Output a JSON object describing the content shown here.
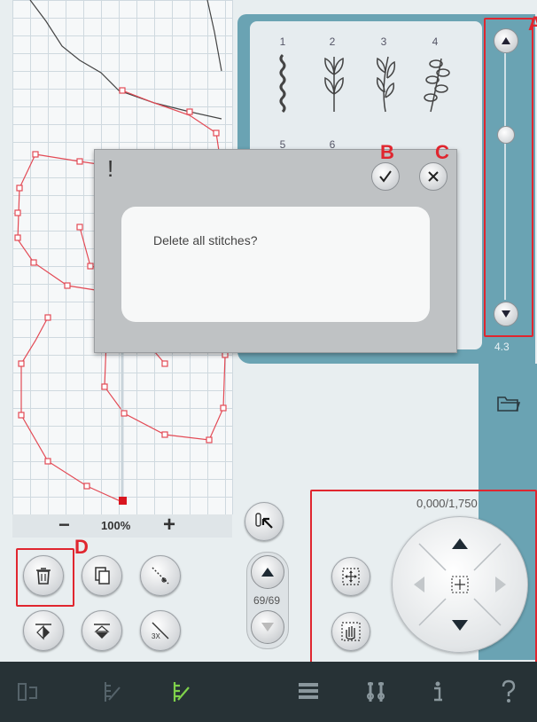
{
  "canvas": {
    "zoom_label": "100%",
    "zoom_out_symbol": "−",
    "zoom_in_symbol": "+"
  },
  "stitch_panel": {
    "stitches": [
      {
        "num": "1",
        "icon": "stitch-1-icon"
      },
      {
        "num": "2",
        "icon": "stitch-2-icon"
      },
      {
        "num": "3",
        "icon": "stitch-3-icon"
      },
      {
        "num": "4",
        "icon": "stitch-4-icon"
      },
      {
        "num": "5",
        "icon": "stitch-5-icon"
      },
      {
        "num": "6",
        "icon": "stitch-6-icon"
      }
    ],
    "slider_value": "4.3",
    "slider_label": "A"
  },
  "dialog": {
    "title_symbol": "!",
    "message": "Delete all stitches?",
    "confirm_label": "B",
    "cancel_label": "C"
  },
  "toolbar": {
    "delete_label": "D"
  },
  "stitch_position": {
    "counter": "69/69"
  },
  "move_panel": {
    "coordinates": "0,000/1,750"
  },
  "colors": {
    "accent": "#6aa3b3",
    "highlight": "#e0262f",
    "stitch_line": "#e34a55",
    "taskbar": "#273236"
  }
}
